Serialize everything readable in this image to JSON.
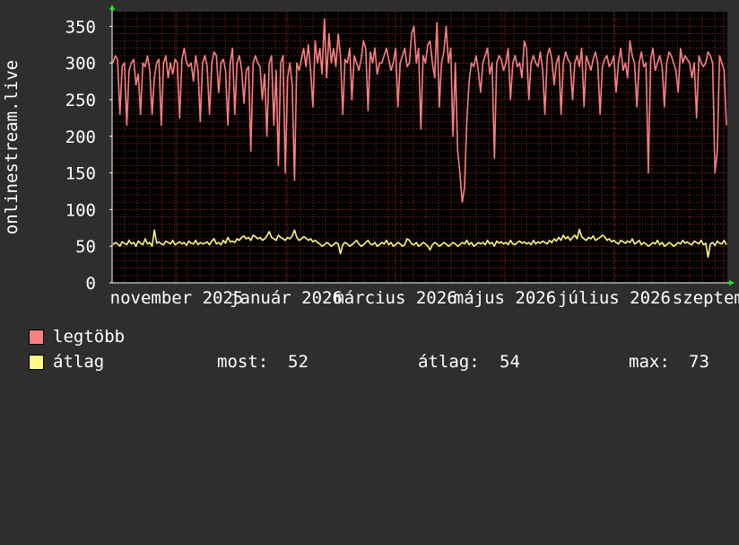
{
  "chart_data": {
    "type": "line",
    "ylabel": "onlinestream.live",
    "ylim": [
      0,
      370
    ],
    "yticks": [
      0,
      50,
      100,
      150,
      200,
      250,
      300,
      350
    ],
    "xlabels": [
      "november 2025",
      "január 2026",
      "március 2026",
      "május 2026",
      "július 2026",
      "szeptember"
    ],
    "grid": true,
    "legend_placement": "bottom",
    "colors": {
      "legtobb": "#f98081",
      "atlag": "#fdf987",
      "grid": "#8a2b2b",
      "plot_bg": "#000000",
      "axis_arrow": "#00ff00"
    },
    "series": [
      {
        "name": "legtöbb",
        "values": [
          300,
          310,
          305,
          230,
          295,
          300,
          215,
          290,
          300,
          305,
          270,
          285,
          230,
          300,
          295,
          310,
          290,
          230,
          280,
          300,
          305,
          215,
          300,
          310,
          280,
          300,
          285,
          305,
          300,
          225,
          305,
          320,
          300,
          295,
          300,
          275,
          310,
          290,
          220,
          300,
          310,
          295,
          230,
          300,
          315,
          310,
          260,
          300,
          305,
          290,
          215,
          300,
          320,
          230,
          300,
          310,
          290,
          245,
          290,
          295,
          180,
          300,
          310,
          300,
          295,
          250,
          285,
          200,
          300,
          310,
          215,
          290,
          160,
          300,
          310,
          150,
          280,
          300,
          270,
          140,
          300,
          290,
          305,
          320,
          295,
          325,
          290,
          240,
          330,
          300,
          320,
          285,
          360,
          280,
          340,
          300,
          320,
          295,
          340,
          310,
          230,
          305,
          300,
          320,
          250,
          310,
          300,
          290,
          305,
          330,
          320,
          235,
          315,
          300,
          320,
          285,
          300,
          300,
          310,
          320,
          305,
          290,
          300,
          320,
          240,
          300,
          310,
          320,
          295,
          300,
          340,
          350,
          300,
          320,
          210,
          310,
          300,
          325,
          330,
          300,
          280,
          355,
          240,
          300,
          315,
          350,
          300,
          320,
          200,
          300,
          180,
          150,
          110,
          130,
          220,
          275,
          300,
          295,
          310,
          290,
          260,
          300,
          310,
          320,
          285,
          300,
          170,
          300,
          310,
          305,
          290,
          300,
          320,
          250,
          300,
          310,
          295,
          300,
          280,
          330,
          320,
          250,
          300,
          310,
          300,
          295,
          315,
          290,
          230,
          310,
          320,
          305,
          270,
          300,
          310,
          230,
          300,
          315,
          305,
          300,
          250,
          300,
          310,
          295,
          320,
          240,
          310,
          300,
          290,
          305,
          315,
          300,
          230,
          295,
          305,
          310,
          295,
          300,
          310,
          260,
          300,
          320,
          290,
          300,
          280,
          330,
          310,
          300,
          240,
          300,
          315,
          295,
          300,
          150,
          305,
          320,
          290,
          300,
          310,
          295,
          240,
          300,
          315,
          310,
          300,
          290,
          260,
          320,
          300,
          310,
          305,
          300,
          280,
          300,
          225,
          310,
          300,
          295,
          300,
          315,
          310,
          300,
          150,
          180,
          310,
          300,
          290,
          215
        ]
      },
      {
        "name": "átlag",
        "values": [
          52,
          55,
          53,
          50,
          56,
          54,
          52,
          58,
          53,
          55,
          50,
          57,
          54,
          52,
          60,
          53,
          55,
          50,
          72,
          54,
          56,
          53,
          52,
          57,
          55,
          53,
          58,
          52,
          54,
          56,
          53,
          55,
          51,
          57,
          54,
          53,
          58,
          52,
          55,
          53,
          54,
          56,
          52,
          57,
          60,
          53,
          55,
          52,
          58,
          54,
          62,
          56,
          57,
          55,
          60,
          58,
          62,
          64,
          60,
          62,
          58,
          65,
          63,
          60,
          62,
          58,
          60,
          64,
          70,
          62,
          60,
          58,
          65,
          62,
          60,
          58,
          62,
          60,
          64,
          72,
          62,
          58,
          60,
          63,
          61,
          58,
          60,
          56,
          58,
          55,
          53,
          50,
          52,
          55,
          53,
          50,
          52,
          55,
          53,
          40,
          52,
          55,
          53,
          50,
          52,
          55,
          58,
          53,
          50,
          52,
          55,
          58,
          53,
          52,
          55,
          50,
          52,
          55,
          53,
          58,
          52,
          55,
          50,
          52,
          55,
          53,
          50,
          52,
          60,
          58,
          53,
          52,
          55,
          50,
          52,
          55,
          53,
          50,
          45,
          52,
          55,
          53,
          50,
          52,
          55,
          53,
          50,
          52,
          55,
          53,
          50,
          52,
          55,
          53,
          58,
          52,
          55,
          50,
          52,
          55,
          53,
          55,
          52,
          58,
          53,
          55,
          50,
          57,
          54,
          56,
          53,
          55,
          52,
          58,
          53,
          52,
          55,
          57,
          54,
          56,
          53,
          55,
          52,
          58,
          53,
          56,
          54,
          57,
          55,
          53,
          58,
          55,
          60,
          57,
          62,
          58,
          65,
          60,
          63,
          58,
          62,
          65,
          60,
          73,
          63,
          60,
          58,
          62,
          60,
          64,
          58,
          60,
          62,
          65,
          63,
          58,
          60,
          56,
          58,
          55,
          53,
          58,
          56,
          54,
          57,
          55,
          60,
          53,
          55,
          58,
          52,
          55,
          53,
          50,
          52,
          55,
          53,
          58,
          52,
          55,
          50,
          52,
          55,
          53,
          50,
          52,
          55,
          53,
          58,
          54,
          56,
          53,
          52,
          57,
          55,
          53,
          58,
          52,
          54,
          35,
          53,
          55,
          51,
          57,
          54,
          53,
          58,
          52
        ]
      }
    ]
  },
  "legend": {
    "items": [
      {
        "label": "legtöbb"
      },
      {
        "label": "átlag"
      }
    ],
    "stats": {
      "now_label": "most:",
      "now_value": "52",
      "avg_label": "átlag:",
      "avg_value": "54",
      "max_label": "max:",
      "max_value": "73"
    }
  }
}
